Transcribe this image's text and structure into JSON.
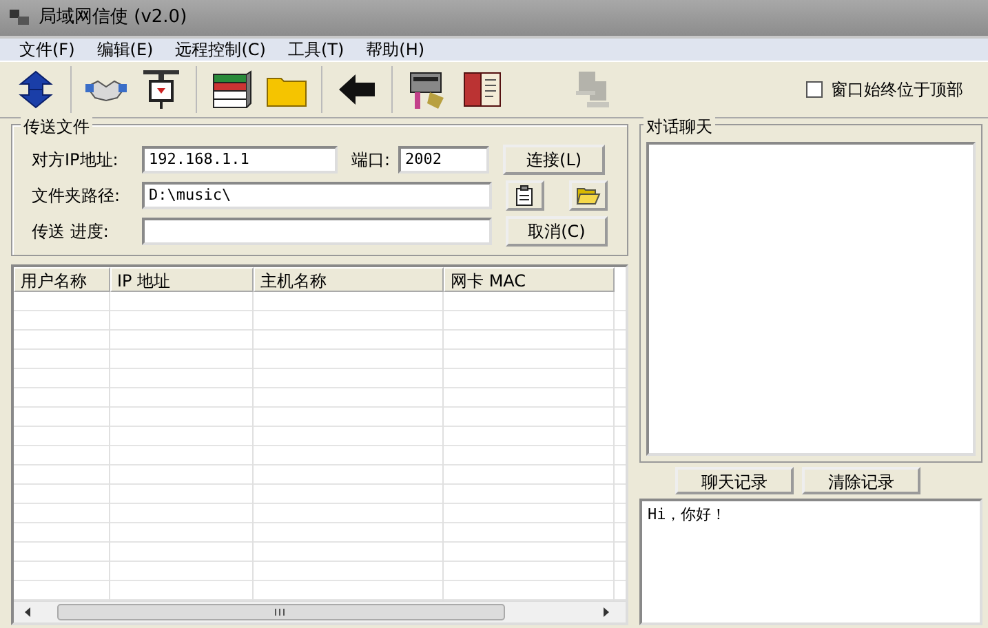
{
  "window": {
    "title": "局域网信使 (v2.0)"
  },
  "menu": [
    "文件(F)",
    "编辑(E)",
    "远程控制(C)",
    "工具(T)",
    "帮助(H)"
  ],
  "toolbar": [
    {
      "kind": "refresh",
      "disabled": false
    },
    {
      "kind": "handshake",
      "disabled": false
    },
    {
      "kind": "plug",
      "disabled": false
    },
    {
      "kind": "books",
      "disabled": false
    },
    {
      "kind": "folder",
      "disabled": false
    },
    {
      "kind": "back",
      "disabled": false
    },
    {
      "kind": "machine",
      "disabled": false
    },
    {
      "kind": "book",
      "disabled": false
    },
    {
      "kind": "computers",
      "disabled": true
    }
  ],
  "always_on_top": {
    "label": "窗口始终位于顶部",
    "checked": false
  },
  "transfer": {
    "title": "传送文件",
    "ip_label": "对方IP地址:",
    "ip_value": "192.168.1.1",
    "port_label": "端口:",
    "port_value": "2002",
    "connect_button": "连接(L)",
    "folder_label": "文件夹路径:",
    "folder_value": "D:\\music\\",
    "progress_label": "传送 进度:",
    "progress": {
      "level": 0
    },
    "cancel_button": "取消(C)"
  },
  "table": {
    "columns": [
      "用户名称",
      "IP 地址",
      "主机名称",
      "网卡 MAC"
    ]
  },
  "chat": {
    "title": "对话聊天",
    "history_button": "聊天记录",
    "clear_button": "清除记录",
    "input_value": "Hi，你好！"
  }
}
